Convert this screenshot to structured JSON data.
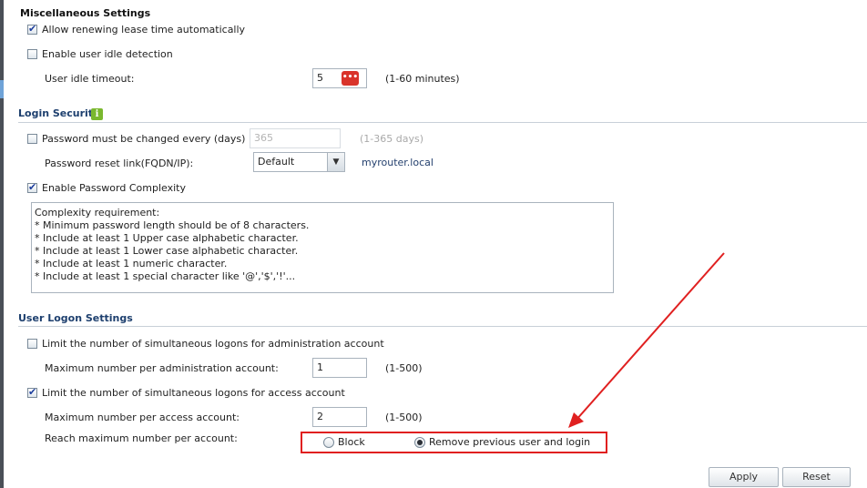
{
  "misc": {
    "title": "Miscellaneous Settings",
    "renew_lease_label": "Allow renewing lease time automatically",
    "renew_lease_checked": true,
    "idle_detect_label": "Enable user idle detection",
    "idle_detect_checked": false,
    "idle_timeout_label": "User idle timeout:",
    "idle_timeout_value": "5",
    "idle_timeout_hint": "(1-60 minutes)"
  },
  "login_security": {
    "title": "Login Security",
    "info_icon": "i",
    "pwd_change_label": "Password must be changed every (days)",
    "pwd_change_checked": false,
    "pwd_change_value": "365",
    "pwd_change_hint": "(1-365 days)",
    "reset_link_label": "Password reset link(FQDN/IP):",
    "reset_link_select": "Default",
    "reset_link_value": "myrouter.local",
    "complexity_label": "Enable Password Complexity",
    "complexity_checked": true,
    "complexity_lines": [
      "Complexity requirement:",
      "* Minimum password length should be of 8 characters.",
      "* Include at least 1 Upper case alphabetic character.",
      "* Include at least 1 Lower case alphabetic character.",
      "* Include at least 1 numeric character.",
      "* Include at least 1 special character like '@','$','!'..."
    ]
  },
  "user_logon": {
    "title": "User Logon Settings",
    "limit_admin_label": "Limit the number of simultaneous logons for administration account",
    "limit_admin_checked": false,
    "max_admin_label": "Maximum number per administration account:",
    "max_admin_value": "1",
    "max_admin_hint": "(1-500)",
    "limit_access_label": "Limit the number of simultaneous logons for access account",
    "limit_access_checked": true,
    "max_access_label": "Maximum number per access account:",
    "max_access_value": "2",
    "max_access_hint": "(1-500)",
    "reach_max_label": "Reach maximum number per account:",
    "radio_block_label": "Block",
    "radio_remove_label": "Remove previous user and login",
    "selected_option": "remove"
  },
  "buttons": {
    "apply": "Apply",
    "reset": "Reset"
  },
  "icons": {
    "keypad": "keypad-icon",
    "info": "info-icon",
    "dropdown": "chevron-down-icon"
  },
  "colors": {
    "section_title": "#1d3f6e",
    "annotation": "#e02020",
    "info_icon": "#7ab82e",
    "keypad_icon": "#d9342b"
  }
}
